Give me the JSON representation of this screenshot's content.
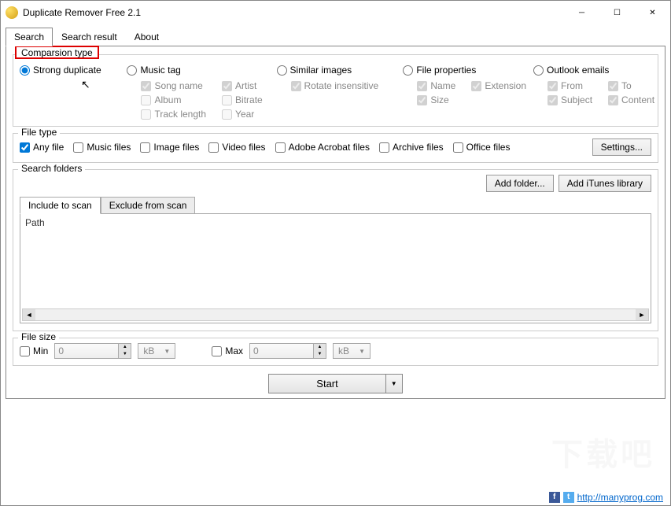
{
  "window": {
    "title": "Duplicate Remover Free 2.1"
  },
  "tabs": {
    "search": "Search",
    "result": "Search result",
    "about": "About"
  },
  "comparison": {
    "legend": "Comparsion type",
    "strong": "Strong duplicate",
    "music": "Music tag",
    "music_opts": {
      "song": "Song name",
      "artist": "Artist",
      "album": "Album",
      "bitrate": "Bitrate",
      "track": "Track length",
      "year": "Year"
    },
    "similar": "Similar images",
    "similar_opts": {
      "rotate": "Rotate insensitive"
    },
    "fileprops": "File properties",
    "fileprops_opts": {
      "name": "Name",
      "ext": "Extension",
      "size": "Size"
    },
    "outlook": "Outlook emails",
    "outlook_opts": {
      "from": "From",
      "to": "To",
      "subject": "Subject",
      "content": "Content"
    }
  },
  "filetype": {
    "legend": "File type",
    "any": "Any file",
    "music": "Music files",
    "image": "Image files",
    "video": "Video files",
    "acrobat": "Adobe Acrobat files",
    "archive": "Archive files",
    "office": "Office files",
    "settings": "Settings..."
  },
  "folders": {
    "legend": "Search folders",
    "add": "Add folder...",
    "itunes": "Add iTunes library",
    "include": "Include to scan",
    "exclude": "Exclude from scan",
    "path_header": "Path"
  },
  "filesize": {
    "legend": "File size",
    "min": "Min",
    "min_val": "0",
    "min_unit": "kB",
    "max": "Max",
    "max_val": "0",
    "max_unit": "kB"
  },
  "actions": {
    "start": "Start"
  },
  "footer": {
    "url": "http://manyprog.com"
  }
}
